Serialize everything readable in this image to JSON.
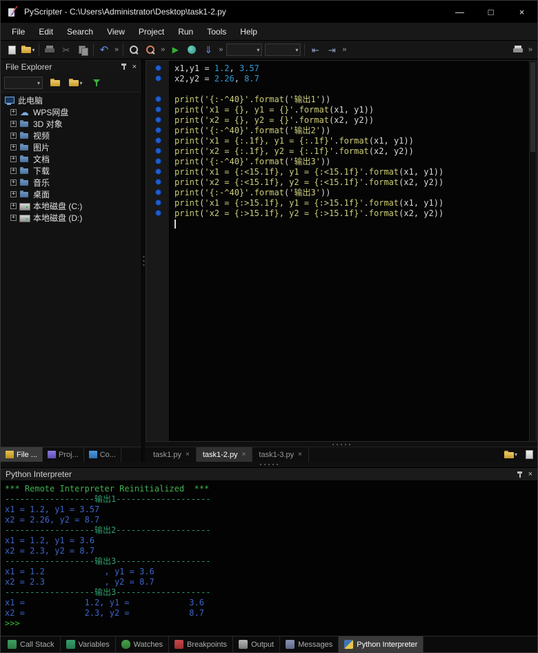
{
  "window": {
    "title": "PyScripter - C:\\Users\\Administrator\\Desktop\\task1-2.py"
  },
  "icon_glyphs": {
    "minimize": "—",
    "maximize": "□",
    "close": "×",
    "dropdown": "▾",
    "overflow": "»",
    "expander_plus": "+",
    "cloud": "☁",
    "undo": "↶",
    "run": "▶",
    "cut": "✂",
    "step": "⇓",
    "indent": "⇥",
    "dedent": "⇤"
  },
  "menubar": {
    "items": [
      "File",
      "Edit",
      "Search",
      "View",
      "Project",
      "Run",
      "Tools",
      "Help"
    ]
  },
  "file_explorer": {
    "title": "File Explorer",
    "tree": [
      {
        "label": "此电脑",
        "icon": "computer",
        "expander": false,
        "level": 0
      },
      {
        "label": "WPS网盘",
        "icon": "cloud",
        "expander": true,
        "level": 1
      },
      {
        "label": "3D 对象",
        "icon": "folder",
        "expander": true,
        "level": 1
      },
      {
        "label": "视频",
        "icon": "folder",
        "expander": true,
        "level": 1
      },
      {
        "label": "图片",
        "icon": "folder",
        "expander": true,
        "level": 1
      },
      {
        "label": "文档",
        "icon": "folder",
        "expander": true,
        "level": 1
      },
      {
        "label": "下载",
        "icon": "folder",
        "expander": true,
        "level": 1
      },
      {
        "label": "音乐",
        "icon": "folder",
        "expander": true,
        "level": 1
      },
      {
        "label": "桌面",
        "icon": "folder",
        "expander": true,
        "level": 1
      },
      {
        "label": "本地磁盘 (C:)",
        "icon": "drive",
        "expander": true,
        "level": 1
      },
      {
        "label": "本地磁盘 (D:)",
        "icon": "drive",
        "expander": true,
        "level": 1
      }
    ],
    "tabs": [
      {
        "id": "file",
        "label": "File ...",
        "active": true
      },
      {
        "id": "proj",
        "label": "Proj...",
        "active": false
      },
      {
        "id": "code",
        "label": "Co...",
        "active": false
      }
    ]
  },
  "editor": {
    "tabs": [
      {
        "label": "task1.py",
        "active": false
      },
      {
        "label": "task1-2.py",
        "active": true
      },
      {
        "label": "task1-3.py",
        "active": false
      }
    ],
    "code": [
      {
        "m": true,
        "t": [
          [
            "d",
            "x1,y1 = "
          ],
          [
            "n",
            "1.2"
          ],
          [
            "d",
            ", "
          ],
          [
            "n",
            "3.57"
          ]
        ]
      },
      {
        "m": true,
        "t": [
          [
            "d",
            "x2,y2 = "
          ],
          [
            "n",
            "2.26"
          ],
          [
            "d",
            ", "
          ],
          [
            "n",
            "8.7"
          ]
        ]
      },
      {
        "m": false,
        "t": []
      },
      {
        "m": true,
        "t": [
          [
            "k",
            "print"
          ],
          [
            "p",
            "("
          ],
          [
            "s",
            "'{:-^40}'"
          ],
          [
            "p",
            "."
          ],
          [
            "k",
            "format"
          ],
          [
            "p",
            "("
          ],
          [
            "s",
            "'输出1'"
          ],
          [
            "p",
            "))"
          ]
        ]
      },
      {
        "m": true,
        "t": [
          [
            "k",
            "print"
          ],
          [
            "p",
            "("
          ],
          [
            "s",
            "'x1 = {}, y1 = {}'"
          ],
          [
            "p",
            "."
          ],
          [
            "k",
            "format"
          ],
          [
            "p",
            "("
          ],
          [
            "d",
            "x1"
          ],
          [
            "p",
            ", "
          ],
          [
            "d",
            "y1"
          ],
          [
            "p",
            "))"
          ]
        ]
      },
      {
        "m": true,
        "t": [
          [
            "k",
            "print"
          ],
          [
            "p",
            "("
          ],
          [
            "s",
            "'x2 = {}, y2 = {}'"
          ],
          [
            "p",
            "."
          ],
          [
            "k",
            "format"
          ],
          [
            "p",
            "("
          ],
          [
            "d",
            "x2"
          ],
          [
            "p",
            ", "
          ],
          [
            "d",
            "y2"
          ],
          [
            "p",
            "))"
          ]
        ]
      },
      {
        "m": true,
        "t": [
          [
            "k",
            "print"
          ],
          [
            "p",
            "("
          ],
          [
            "s",
            "'{:-^40}'"
          ],
          [
            "p",
            "."
          ],
          [
            "k",
            "format"
          ],
          [
            "p",
            "("
          ],
          [
            "s",
            "'输出2'"
          ],
          [
            "p",
            "))"
          ]
        ]
      },
      {
        "m": true,
        "t": [
          [
            "k",
            "print"
          ],
          [
            "p",
            "("
          ],
          [
            "s",
            "'x1 = {:.1f}, y1 = {:.1f}'"
          ],
          [
            "p",
            "."
          ],
          [
            "k",
            "format"
          ],
          [
            "p",
            "("
          ],
          [
            "d",
            "x1"
          ],
          [
            "p",
            ", "
          ],
          [
            "d",
            "y1"
          ],
          [
            "p",
            "))"
          ]
        ]
      },
      {
        "m": true,
        "t": [
          [
            "k",
            "print"
          ],
          [
            "p",
            "("
          ],
          [
            "s",
            "'x2 = {:.1f}, y2 = {:.1f}'"
          ],
          [
            "p",
            "."
          ],
          [
            "k",
            "format"
          ],
          [
            "p",
            "("
          ],
          [
            "d",
            "x2"
          ],
          [
            "p",
            ", "
          ],
          [
            "d",
            "y2"
          ],
          [
            "p",
            "))"
          ]
        ]
      },
      {
        "m": true,
        "t": [
          [
            "k",
            "print"
          ],
          [
            "p",
            "("
          ],
          [
            "s",
            "'{:-^40}'"
          ],
          [
            "p",
            "."
          ],
          [
            "k",
            "format"
          ],
          [
            "p",
            "("
          ],
          [
            "s",
            "'输出3'"
          ],
          [
            "p",
            "))"
          ]
        ]
      },
      {
        "m": true,
        "t": [
          [
            "k",
            "print"
          ],
          [
            "p",
            "("
          ],
          [
            "s",
            "'x1 = {:<15.1f}, y1 = {:<15.1f}'"
          ],
          [
            "p",
            "."
          ],
          [
            "k",
            "format"
          ],
          [
            "p",
            "("
          ],
          [
            "d",
            "x1"
          ],
          [
            "p",
            ", "
          ],
          [
            "d",
            "y1"
          ],
          [
            "p",
            "))"
          ]
        ]
      },
      {
        "m": true,
        "t": [
          [
            "k",
            "print"
          ],
          [
            "p",
            "("
          ],
          [
            "s",
            "'x2 = {:<15.1f}, y2 = {:<15.1f}'"
          ],
          [
            "p",
            "."
          ],
          [
            "k",
            "format"
          ],
          [
            "p",
            "("
          ],
          [
            "d",
            "x2"
          ],
          [
            "p",
            ", "
          ],
          [
            "d",
            "y2"
          ],
          [
            "p",
            "))"
          ]
        ]
      },
      {
        "m": true,
        "t": [
          [
            "k",
            "print"
          ],
          [
            "p",
            "("
          ],
          [
            "s",
            "'{:-^40}'"
          ],
          [
            "p",
            "."
          ],
          [
            "k",
            "format"
          ],
          [
            "p",
            "("
          ],
          [
            "s",
            "'输出3'"
          ],
          [
            "p",
            "))"
          ]
        ]
      },
      {
        "m": true,
        "t": [
          [
            "k",
            "print"
          ],
          [
            "p",
            "("
          ],
          [
            "s",
            "'x1 = {:>15.1f}, y1 = {:>15.1f}'"
          ],
          [
            "p",
            "."
          ],
          [
            "k",
            "format"
          ],
          [
            "p",
            "("
          ],
          [
            "d",
            "x1"
          ],
          [
            "p",
            ", "
          ],
          [
            "d",
            "y1"
          ],
          [
            "p",
            "))"
          ]
        ]
      },
      {
        "m": true,
        "t": [
          [
            "k",
            "print"
          ],
          [
            "p",
            "("
          ],
          [
            "s",
            "'x2 = {:>15.1f}, y2 = {:>15.1f}'"
          ],
          [
            "p",
            "."
          ],
          [
            "k",
            "format"
          ],
          [
            "p",
            "("
          ],
          [
            "d",
            "x2"
          ],
          [
            "p",
            ", "
          ],
          [
            "d",
            "y2"
          ],
          [
            "p",
            "))"
          ]
        ]
      },
      {
        "m": false,
        "t": [],
        "caret": true
      }
    ]
  },
  "interpreter": {
    "title": "Python Interpreter",
    "lines": [
      {
        "c": "sys",
        "t": "*** Remote Interpreter Reinitialized  ***"
      },
      {
        "c": "sep",
        "t": "------------------输出1-------------------"
      },
      {
        "c": "val",
        "t": "x1 = 1.2, y1 = 3.57"
      },
      {
        "c": "val",
        "t": "x2 = 2.26, y2 = 8.7"
      },
      {
        "c": "sep",
        "t": "------------------输出2-------------------"
      },
      {
        "c": "val",
        "t": "x1 = 1.2, y1 = 3.6"
      },
      {
        "c": "val",
        "t": "x2 = 2.3, y2 = 8.7"
      },
      {
        "c": "sep",
        "t": "------------------输出3-------------------"
      },
      {
        "c": "val",
        "t": "x1 = 1.2            , y1 = 3.6"
      },
      {
        "c": "val",
        "t": "x2 = 2.3            , y2 = 8.7"
      },
      {
        "c": "sep",
        "t": "------------------输出3-------------------"
      },
      {
        "c": "val",
        "t": "x1 =            1.2, y1 =            3.6"
      },
      {
        "c": "val",
        "t": "x2 =            2.3, y2 =            8.7"
      },
      {
        "c": "prompt",
        "t": ">>>"
      }
    ]
  },
  "bottom_tabs": [
    {
      "icon": "callstack",
      "label": "Call Stack",
      "active": false
    },
    {
      "icon": "variables",
      "label": "Variables",
      "active": false
    },
    {
      "icon": "watches",
      "label": "Watches",
      "active": false
    },
    {
      "icon": "breakpoints",
      "label": "Breakpoints",
      "active": false
    },
    {
      "icon": "output",
      "label": "Output",
      "active": false
    },
    {
      "icon": "messages",
      "label": "Messages",
      "active": false
    },
    {
      "icon": "python",
      "label": "Python Interpreter",
      "active": true
    }
  ],
  "colors": {
    "titlebar-bg": "#000000",
    "editor-bg": "#050505",
    "code-default": "#d8d8d8",
    "code-number": "#2f9bd6",
    "code-keyword": "#c9c974",
    "code-string": "#cdcd7e",
    "interp-system": "#3faf4f",
    "interp-separator": "#2e9f6e",
    "interp-output": "#3c66c8",
    "interp-prompt": "#2fc02f",
    "marker-blue": "#1e5ed0",
    "run-green": "#2fb52f",
    "folder-yellow": "#d8a33c"
  }
}
